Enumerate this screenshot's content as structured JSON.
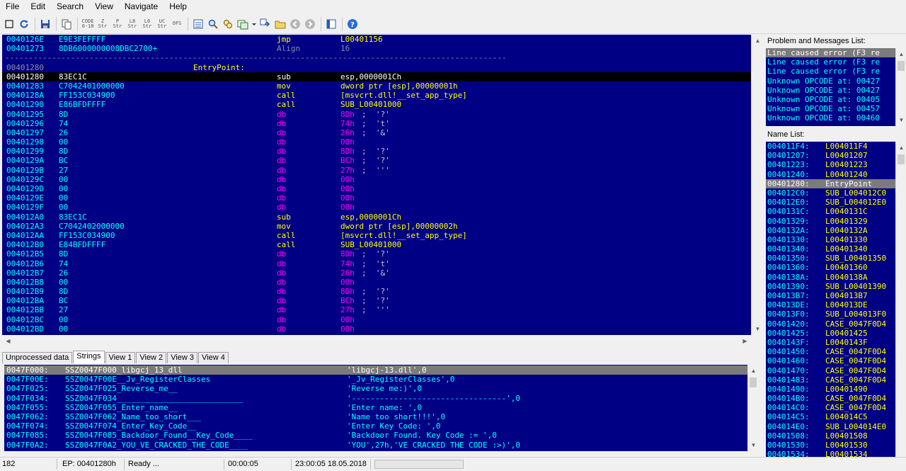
{
  "menu": [
    "File",
    "Edit",
    "Search",
    "View",
    "Navigate",
    "Help"
  ],
  "toolbar": {
    "str_labels": [
      "CODE 0-10",
      "Z Str",
      "P Str",
      "L8 Str",
      "L6 Str",
      "UC Str",
      "OFS"
    ]
  },
  "disasm": {
    "rows": [
      {
        "addr": "0040126E",
        "hex": "E9E3FEFFFF",
        "mn": "jmp",
        "op": "L00401156",
        "kind": "code"
      },
      {
        "addr": "00401273",
        "hex": "8DB6000000008DBC2700+",
        "mn": "Align",
        "op": "16",
        "kind": "align"
      },
      {
        "addr": ";",
        "hex": "",
        "mn": "",
        "op": "",
        "kind": "separator",
        "text": "-----------------------------------------------------------------------------------------------------------"
      },
      {
        "addr": "00401280",
        "hex": "",
        "mn": "",
        "op": "",
        "kind": "label",
        "label": "EntryPoint:"
      },
      {
        "addr": "00401280",
        "hex": "83EC1C",
        "mn": "sub",
        "op": "esp,0000001Ch",
        "kind": "code",
        "selected": true
      },
      {
        "addr": "00401283",
        "hex": "C7042401000000",
        "mn": "mov",
        "op": "dword ptr [esp],00000001h",
        "kind": "code"
      },
      {
        "addr": "0040128A",
        "hex": "FF153C034900",
        "mn": "call",
        "op": "[msvcrt.dll!__set_app_type]",
        "kind": "code"
      },
      {
        "addr": "00401290",
        "hex": "E86BFDFFFF",
        "mn": "call",
        "op": "SUB_L00401000",
        "kind": "code"
      },
      {
        "addr": "00401295",
        "hex": "8D",
        "mn": "db",
        "op": "8Dh",
        "cmt": ";  '?'",
        "kind": "db"
      },
      {
        "addr": "00401296",
        "hex": "74",
        "mn": "db",
        "op": "74h",
        "cmt": ";  't'",
        "kind": "db"
      },
      {
        "addr": "00401297",
        "hex": "26",
        "mn": "db",
        "op": "26h",
        "cmt": ";  '&'",
        "kind": "db"
      },
      {
        "addr": "00401298",
        "hex": "00",
        "mn": "db",
        "op": "00h",
        "kind": "db"
      },
      {
        "addr": "00401299",
        "hex": "8D",
        "mn": "db",
        "op": "8Dh",
        "cmt": ";  '?'",
        "kind": "db"
      },
      {
        "addr": "0040129A",
        "hex": "BC",
        "mn": "db",
        "op": "BCh",
        "cmt": ";  '?'",
        "kind": "db"
      },
      {
        "addr": "0040129B",
        "hex": "27",
        "mn": "db",
        "op": "27h",
        "cmt": ";  '''",
        "kind": "db"
      },
      {
        "addr": "0040129C",
        "hex": "00",
        "mn": "db",
        "op": "00h",
        "kind": "db"
      },
      {
        "addr": "0040129D",
        "hex": "00",
        "mn": "db",
        "op": "00h",
        "kind": "db"
      },
      {
        "addr": "0040129E",
        "hex": "00",
        "mn": "db",
        "op": "00h",
        "kind": "db"
      },
      {
        "addr": "0040129F",
        "hex": "00",
        "mn": "db",
        "op": "00h",
        "kind": "db"
      },
      {
        "addr": "004012A0",
        "hex": "83EC1C",
        "mn": "sub",
        "op": "esp,0000001Ch",
        "kind": "code"
      },
      {
        "addr": "004012A3",
        "hex": "C7042402000000",
        "mn": "mov",
        "op": "dword ptr [esp],00000002h",
        "kind": "code"
      },
      {
        "addr": "004012AA",
        "hex": "FF153C034900",
        "mn": "call",
        "op": "[msvcrt.dll!__set_app_type]",
        "kind": "code"
      },
      {
        "addr": "004012B0",
        "hex": "E84BFDFFFF",
        "mn": "call",
        "op": "SUB_L00401000",
        "kind": "code"
      },
      {
        "addr": "004012B5",
        "hex": "8D",
        "mn": "db",
        "op": "8Dh",
        "cmt": ";  '?'",
        "kind": "db"
      },
      {
        "addr": "004012B6",
        "hex": "74",
        "mn": "db",
        "op": "74h",
        "cmt": ";  't'",
        "kind": "db"
      },
      {
        "addr": "004012B7",
        "hex": "26",
        "mn": "db",
        "op": "26h",
        "cmt": ";  '&'",
        "kind": "db"
      },
      {
        "addr": "004012B8",
        "hex": "00",
        "mn": "db",
        "op": "00h",
        "kind": "db"
      },
      {
        "addr": "004012B9",
        "hex": "8D",
        "mn": "db",
        "op": "8Dh",
        "cmt": ";  '?'",
        "kind": "db"
      },
      {
        "addr": "004012BA",
        "hex": "BC",
        "mn": "db",
        "op": "BCh",
        "cmt": ";  '?'",
        "kind": "db"
      },
      {
        "addr": "004012BB",
        "hex": "27",
        "mn": "db",
        "op": "27h",
        "cmt": ";  '''",
        "kind": "db"
      },
      {
        "addr": "004012BC",
        "hex": "00",
        "mn": "db",
        "op": "00h",
        "kind": "db"
      },
      {
        "addr": "004012BD",
        "hex": "00",
        "mn": "db",
        "op": "00h",
        "kind": "db"
      }
    ]
  },
  "tabs": [
    {
      "label": "Unprocessed data",
      "active": false
    },
    {
      "label": "Strings",
      "active": true
    },
    {
      "label": "View 1",
      "active": false
    },
    {
      "label": "View 2",
      "active": false
    },
    {
      "label": "View 3",
      "active": false
    },
    {
      "label": "View 4",
      "active": false
    }
  ],
  "strings": {
    "rows": [
      {
        "addr": "0047F000:",
        "name": "SSZ0047F000_libgcj_13_dll",
        "value": "'libgcj-13.dll',0",
        "selected": true
      },
      {
        "addr": "0047F00E:",
        "name": "SSZ0047F00E__Jv_RegisterClasses",
        "value": "'_Jv_RegisterClasses',0"
      },
      {
        "addr": "0047F025:",
        "name": "SSZ0047F025_Reverse_me__",
        "value": "'Reverse me:)',0"
      },
      {
        "addr": "0047F034:",
        "name": "SSZ0047F034___________________________",
        "value": "'---------------------------------',0"
      },
      {
        "addr": "0047F055:",
        "name": "SSZ0047F055_Enter_name__",
        "value": "'Enter name: ',0"
      },
      {
        "addr": "0047F062:",
        "name": "SSZ0047F062_Name_too_short___",
        "value": "'Name too short!!!',0"
      },
      {
        "addr": "0047F074:",
        "name": "SSZ0047F074_Enter_Key_Code__",
        "value": "'Enter Key Code: ',0"
      },
      {
        "addr": "0047F085:",
        "name": "SSZ0047F085_Backdoor_Found__Key_Code____",
        "value": "'Backdoor Found. Key Code := ',0"
      },
      {
        "addr": "0047F0A2:",
        "name": "SSZ0047F0A2_YOU_VE_CRACKED_THE_CODE____",
        "value": "'YOU',27h,'VE CRACKED THE CODE :>)',0"
      }
    ]
  },
  "problems": {
    "label": "Problem and Messages List:",
    "rows": [
      {
        "text": "Line caused error (F3 re",
        "selected": true
      },
      {
        "text": "Line caused error (F3 re"
      },
      {
        "text": "Line caused error (F3 re"
      },
      {
        "text": "Unknown OPCODE at: 00427"
      },
      {
        "text": "Unknown OPCODE at: 00427"
      },
      {
        "text": "Unknown OPCODE at: 00405"
      },
      {
        "text": "Unknown OPCODE at: 00457"
      },
      {
        "text": "Unknown OPCODE at: 00460"
      }
    ]
  },
  "names": {
    "label": "Name List:",
    "rows": [
      {
        "addr": "004011F4:",
        "name": "L004011F4"
      },
      {
        "addr": "00401207:",
        "name": "L00401207"
      },
      {
        "addr": "00401223:",
        "name": "L00401223"
      },
      {
        "addr": "00401240:",
        "name": "L00401240"
      },
      {
        "addr": "00401280:",
        "name": "EntryPoint",
        "selected": true
      },
      {
        "addr": "004012C0:",
        "name": "SUB_L004012C0"
      },
      {
        "addr": "004012E0:",
        "name": "SUB_L004012E0"
      },
      {
        "addr": "0040131C:",
        "name": "L0040131C"
      },
      {
        "addr": "00401329:",
        "name": "L00401329"
      },
      {
        "addr": "0040132A:",
        "name": "L0040132A"
      },
      {
        "addr": "00401330:",
        "name": "L00401330"
      },
      {
        "addr": "00401340:",
        "name": "L00401340"
      },
      {
        "addr": "00401350:",
        "name": "SUB_L00401350"
      },
      {
        "addr": "00401360:",
        "name": "L00401360"
      },
      {
        "addr": "0040138A:",
        "name": "L0040138A"
      },
      {
        "addr": "00401390:",
        "name": "SUB_L00401390"
      },
      {
        "addr": "004013B7:",
        "name": "L004013B7"
      },
      {
        "addr": "004013DE:",
        "name": "L004013DE"
      },
      {
        "addr": "004013F0:",
        "name": "SUB_L004013F0"
      },
      {
        "addr": "00401420:",
        "name": "CASE_0047F0D4"
      },
      {
        "addr": "00401425:",
        "name": "L00401425"
      },
      {
        "addr": "0040143F:",
        "name": "L0040143F"
      },
      {
        "addr": "00401450:",
        "name": "CASE_0047F0D4"
      },
      {
        "addr": "00401460:",
        "name": "CASE_0047F0D4"
      },
      {
        "addr": "00401470:",
        "name": "CASE_0047F0D4"
      },
      {
        "addr": "00401483:",
        "name": "CASE_0047F0D4"
      },
      {
        "addr": "00401490:",
        "name": "L00401490"
      },
      {
        "addr": "004014B0:",
        "name": "CASE_0047F0D4"
      },
      {
        "addr": "004014C0:",
        "name": "CASE_0047F0D4"
      },
      {
        "addr": "004014C5:",
        "name": "L004014C5"
      },
      {
        "addr": "004014E0:",
        "name": "SUB_L004014E0"
      },
      {
        "addr": "00401508:",
        "name": "L00401508"
      },
      {
        "addr": "00401530:",
        "name": "L00401530"
      },
      {
        "addr": "00401534:",
        "name": "L00401534"
      }
    ]
  },
  "status": {
    "line": "182",
    "ep": "EP: 00401280h",
    "state": "Ready ...",
    "elapsed": "00:00:05",
    "datetime": "23:00:05 18.05.2018",
    "progress": 0
  },
  "colors": {
    "panel_bg": "#000084",
    "address": "#00ffff",
    "mnemonic": "#ffff00",
    "db": "#ff00ff",
    "selection": "#7b7b7b"
  }
}
